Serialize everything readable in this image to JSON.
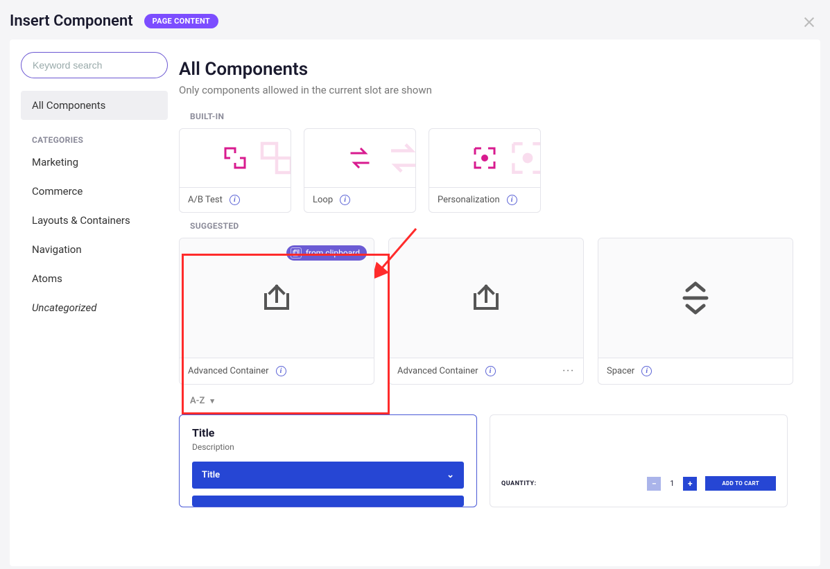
{
  "header": {
    "title": "Insert Component",
    "badge": "PAGE CONTENT"
  },
  "search": {
    "placeholder": "Keyword search"
  },
  "sidebar": {
    "all": "All Components",
    "categories_heading": "CATEGORIES",
    "categories": [
      {
        "label": "Marketing"
      },
      {
        "label": "Commerce"
      },
      {
        "label": "Layouts & Containers"
      },
      {
        "label": "Navigation"
      },
      {
        "label": "Atoms"
      },
      {
        "label": "Uncategorized",
        "italic": true
      }
    ]
  },
  "main": {
    "title": "All Components",
    "subtitle": "Only components allowed in the current slot are shown"
  },
  "built_in": {
    "heading": "BUILT-IN",
    "items": [
      {
        "label": "A/B Test"
      },
      {
        "label": "Loop"
      },
      {
        "label": "Personalization"
      }
    ]
  },
  "suggested": {
    "heading": "SUGGESTED",
    "clipboard_badge": "from clipboard",
    "items": [
      {
        "label": "Advanced Container",
        "from_clipboard": true
      },
      {
        "label": "Advanced Container"
      },
      {
        "label": "Spacer"
      }
    ]
  },
  "sort": {
    "label": "A-Z"
  },
  "previews": {
    "first": {
      "title": "Title",
      "desc": "Description",
      "bar_label": "Title"
    },
    "second": {
      "qty_label": "QUANTITY:",
      "qty_value": "1",
      "add_cart": "ADD TO CART"
    }
  }
}
